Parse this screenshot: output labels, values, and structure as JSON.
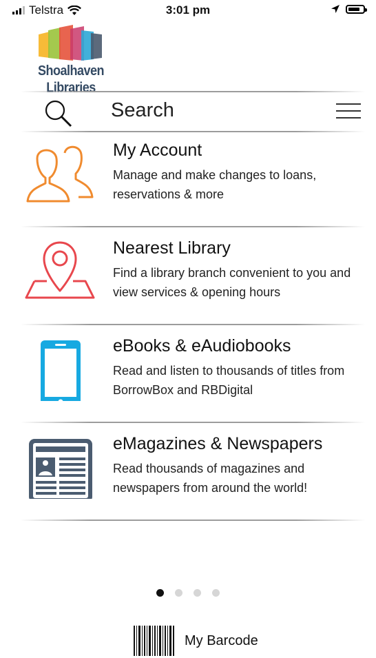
{
  "status": {
    "carrier": "Telstra",
    "time": "3:01 pm",
    "battery_level": 0.8
  },
  "logo": {
    "text": "Shoalhaven Libraries",
    "colors": [
      "#f7b72d",
      "#9ac33b",
      "#e6533c",
      "#c93a6b",
      "#2ea7d6",
      "#4a5a6e"
    ]
  },
  "search": {
    "label": "Search"
  },
  "menu_items": [
    {
      "title": "My Account",
      "description": "Manage and make changes to loans, reservations & more",
      "icon": "account-icon",
      "color": "#f08b2f"
    },
    {
      "title": "Nearest Library",
      "description": "Find a library branch convenient to you and view services & opening hours",
      "icon": "map-pin-icon",
      "color": "#e8474d"
    },
    {
      "title": "eBooks & eAudiobooks",
      "description": "Read and listen to thousands of titles from BorrowBox and RBDigital",
      "icon": "tablet-icon",
      "color": "#17a9e1"
    },
    {
      "title": "eMagazines & Newspapers",
      "description": "Read thousands of magazines and newspapers from around the world!",
      "icon": "newspaper-icon",
      "color": "#4b5c70"
    }
  ],
  "pagination": {
    "pages": 4,
    "active": 1
  },
  "barcode": {
    "label": "My Barcode"
  }
}
